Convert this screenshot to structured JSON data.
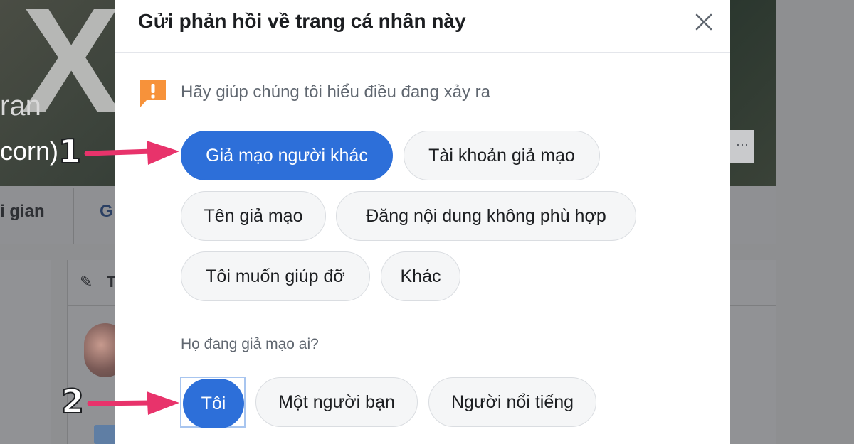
{
  "background": {
    "cover_letter": "X",
    "cover_name": "ran",
    "cover_subtitle": "corn)",
    "cover_button": "···",
    "nav_item_left": "i gian",
    "nav_item_g": "G",
    "card_title_letter": "T"
  },
  "modal": {
    "title": "Gửi phản hồi về trang cá nhân này",
    "close_icon": "close-icon",
    "hint_icon": "exclamation-bubble-icon",
    "hint": "Hãy giúp chúng tôi hiểu điều đang xảy ra",
    "reasons": [
      {
        "label": "Giả mạo người khác",
        "selected": true
      },
      {
        "label": "Tài khoản giả mạo",
        "selected": false
      },
      {
        "label": "Tên giả mạo",
        "selected": false
      },
      {
        "label": "Đăng nội dung không phù hợp",
        "selected": false
      },
      {
        "label": "Tôi muốn giúp đỡ",
        "selected": false
      },
      {
        "label": "Khác",
        "selected": false
      }
    ],
    "question": "Họ đang giả mạo ai?",
    "targets": [
      {
        "label": "Tôi",
        "selected": true
      },
      {
        "label": "Một người bạn",
        "selected": false
      },
      {
        "label": "Người nổi tiếng",
        "selected": false
      }
    ]
  },
  "annotations": {
    "step1": "1",
    "step2": "2"
  },
  "colors": {
    "accent": "#2d6fd9",
    "warning": "#f7923a",
    "annotation_arrow": "#e8336b"
  }
}
